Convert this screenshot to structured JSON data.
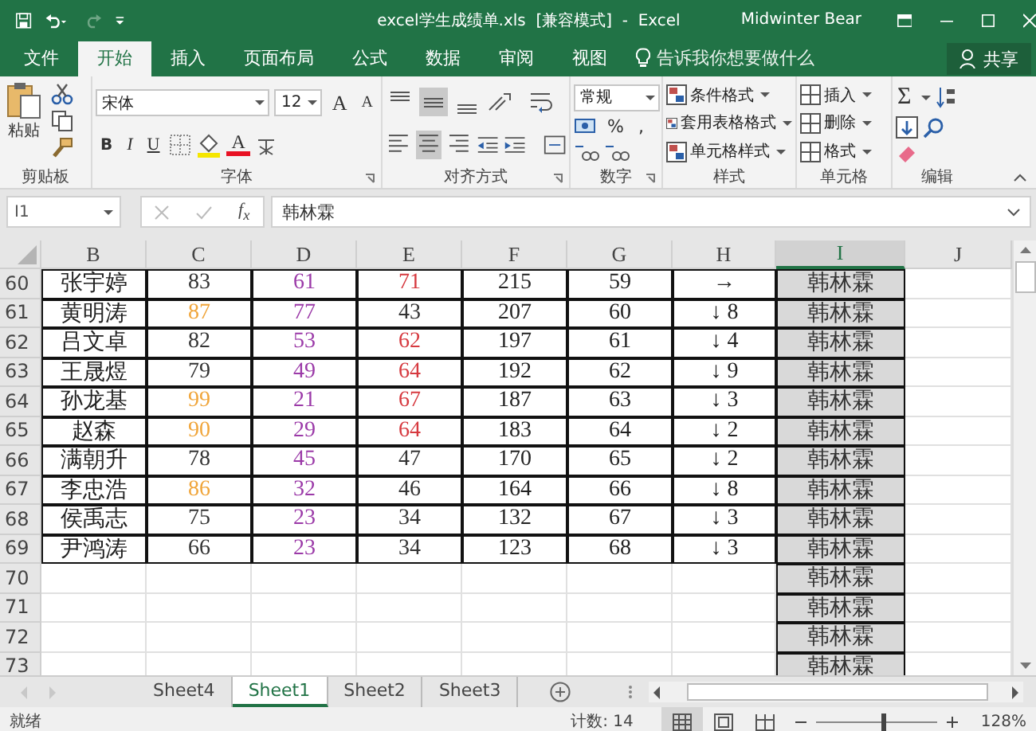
{
  "title_bar": {
    "title": "excel学生成绩单.xls  [兼容模式]  -  Excel",
    "user": "Midwinter Bear"
  },
  "tabs": [
    {
      "label": "文件",
      "selected": false
    },
    {
      "label": "开始",
      "selected": true
    },
    {
      "label": "插入",
      "selected": false
    },
    {
      "label": "页面布局",
      "selected": false
    },
    {
      "label": "公式",
      "selected": false
    },
    {
      "label": "数据",
      "selected": false
    },
    {
      "label": "审阅",
      "selected": false
    },
    {
      "label": "视图",
      "selected": false
    }
  ],
  "tell_me": "告诉我你想要做什么",
  "share": "共享",
  "ribbon": {
    "clipboard": {
      "paste": "粘贴",
      "label": "剪贴板"
    },
    "font": {
      "name": "宋体",
      "size": "12",
      "grow": "A",
      "shrink": "A",
      "bold": "B",
      "italic": "I",
      "underline": "U",
      "color_letter": "A",
      "label": "字体"
    },
    "alignment": {
      "vertical": [
        {
          "kind": "top",
          "selected": false
        },
        {
          "kind": "middle",
          "selected": true
        },
        {
          "kind": "bottom",
          "selected": false
        }
      ],
      "horizontal": [
        {
          "kind": "left",
          "selected": false
        },
        {
          "kind": "center",
          "selected": true
        },
        {
          "kind": "right",
          "selected": false
        }
      ],
      "label": "对齐方式"
    },
    "number": {
      "format": "常规",
      "percent": "%",
      "comma": ",",
      "label": "数字"
    },
    "styles": {
      "items": [
        "条件格式",
        "套用表格格式",
        "单元格样式"
      ],
      "label": "样式"
    },
    "cells": {
      "items": [
        "插入",
        "删除",
        "格式"
      ],
      "label": "单元格"
    },
    "editing": {
      "sum": "Σ",
      "label": "编辑"
    }
  },
  "formula_bar": {
    "name_box": "I1",
    "fx": "f$_{x}$",
    "value": "韩林霖"
  },
  "columns": [
    {
      "label": "B",
      "selected": false
    },
    {
      "label": "C",
      "selected": false
    },
    {
      "label": "D",
      "selected": false
    },
    {
      "label": "E",
      "selected": false
    },
    {
      "label": "F",
      "selected": false
    },
    {
      "label": "G",
      "selected": false
    },
    {
      "label": "H",
      "selected": false
    },
    {
      "label": "I",
      "selected": true
    },
    {
      "label": "J",
      "selected": false
    }
  ],
  "rows": [
    {
      "num": "60",
      "cells": [
        {
          "text": "张宇婷"
        },
        {
          "text": "83",
          "color": "#333333"
        },
        {
          "text": "61",
          "color": "#9b3aa8"
        },
        {
          "text": "71",
          "color": "#d6393f"
        },
        {
          "text": "215"
        },
        {
          "text": "59"
        },
        {
          "text": "→"
        }
      ],
      "i": "韩林霖"
    },
    {
      "num": "61",
      "cells": [
        {
          "text": "黄明涛"
        },
        {
          "text": "87",
          "color": "#f0a53a"
        },
        {
          "text": "77",
          "color": "#9b3aa8"
        },
        {
          "text": "43",
          "color": "#333333"
        },
        {
          "text": "207"
        },
        {
          "text": "60"
        },
        {
          "text": "↓ 8"
        }
      ],
      "i": "韩林霖"
    },
    {
      "num": "62",
      "cells": [
        {
          "text": "吕文卓"
        },
        {
          "text": "82",
          "color": "#333333"
        },
        {
          "text": "53",
          "color": "#9b3aa8"
        },
        {
          "text": "62",
          "color": "#d6393f"
        },
        {
          "text": "197"
        },
        {
          "text": "61"
        },
        {
          "text": "↓ 4"
        }
      ],
      "i": "韩林霖"
    },
    {
      "num": "63",
      "cells": [
        {
          "text": "王晟煜"
        },
        {
          "text": "79",
          "color": "#333333"
        },
        {
          "text": "49",
          "color": "#9b3aa8"
        },
        {
          "text": "64",
          "color": "#d6393f"
        },
        {
          "text": "192"
        },
        {
          "text": "62"
        },
        {
          "text": "↓ 9"
        }
      ],
      "i": "韩林霖"
    },
    {
      "num": "64",
      "cells": [
        {
          "text": "孙龙基"
        },
        {
          "text": "99",
          "color": "#f0a53a"
        },
        {
          "text": "21",
          "color": "#9b3aa8"
        },
        {
          "text": "67",
          "color": "#d6393f"
        },
        {
          "text": "187"
        },
        {
          "text": "63"
        },
        {
          "text": "↓ 3"
        }
      ],
      "i": "韩林霖"
    },
    {
      "num": "65",
      "cells": [
        {
          "text": "赵森"
        },
        {
          "text": "90",
          "color": "#f0a53a"
        },
        {
          "text": "29",
          "color": "#9b3aa8"
        },
        {
          "text": "64",
          "color": "#d6393f"
        },
        {
          "text": "183"
        },
        {
          "text": "64"
        },
        {
          "text": "↓ 2"
        }
      ],
      "i": "韩林霖"
    },
    {
      "num": "66",
      "cells": [
        {
          "text": "满朝升"
        },
        {
          "text": "78",
          "color": "#333333"
        },
        {
          "text": "45",
          "color": "#9b3aa8"
        },
        {
          "text": "47",
          "color": "#333333"
        },
        {
          "text": "170"
        },
        {
          "text": "65"
        },
        {
          "text": "↓ 2"
        }
      ],
      "i": "韩林霖"
    },
    {
      "num": "67",
      "cells": [
        {
          "text": "李忠浩"
        },
        {
          "text": "86",
          "color": "#f0a53a"
        },
        {
          "text": "32",
          "color": "#9b3aa8"
        },
        {
          "text": "46",
          "color": "#333333"
        },
        {
          "text": "164"
        },
        {
          "text": "66"
        },
        {
          "text": "↓ 8"
        }
      ],
      "i": "韩林霖"
    },
    {
      "num": "68",
      "cells": [
        {
          "text": "侯禹志"
        },
        {
          "text": "75",
          "color": "#333333"
        },
        {
          "text": "23",
          "color": "#9b3aa8"
        },
        {
          "text": "34",
          "color": "#333333"
        },
        {
          "text": "132"
        },
        {
          "text": "67"
        },
        {
          "text": "↓ 3"
        }
      ],
      "i": "韩林霖"
    },
    {
      "num": "69",
      "cells": [
        {
          "text": "尹鸿涛"
        },
        {
          "text": "66",
          "color": "#333333"
        },
        {
          "text": "23",
          "color": "#9b3aa8"
        },
        {
          "text": "34",
          "color": "#333333"
        },
        {
          "text": "123"
        },
        {
          "text": "68"
        },
        {
          "text": "↓ 3"
        }
      ],
      "i": "韩林霖"
    },
    {
      "num": "70",
      "i": "韩林霖"
    },
    {
      "num": "71",
      "i": "韩林霖"
    },
    {
      "num": "72",
      "i": "韩林霖"
    },
    {
      "num": "73",
      "i": "韩林霖"
    }
  ],
  "sheets": [
    {
      "label": "Sheet4",
      "selected": false
    },
    {
      "label": "Sheet1",
      "selected": true
    },
    {
      "label": "Sheet2",
      "selected": false
    },
    {
      "label": "Sheet3",
      "selected": false
    }
  ],
  "status": {
    "ready": "就绪",
    "count": "计数: 14",
    "views": [
      {
        "kind": "normal",
        "selected": true
      },
      {
        "kind": "page_layout",
        "selected": false
      },
      {
        "kind": "page_break",
        "selected": false
      }
    ],
    "zoom": {
      "level": 0.55
    },
    "zoom_text": "128%"
  }
}
